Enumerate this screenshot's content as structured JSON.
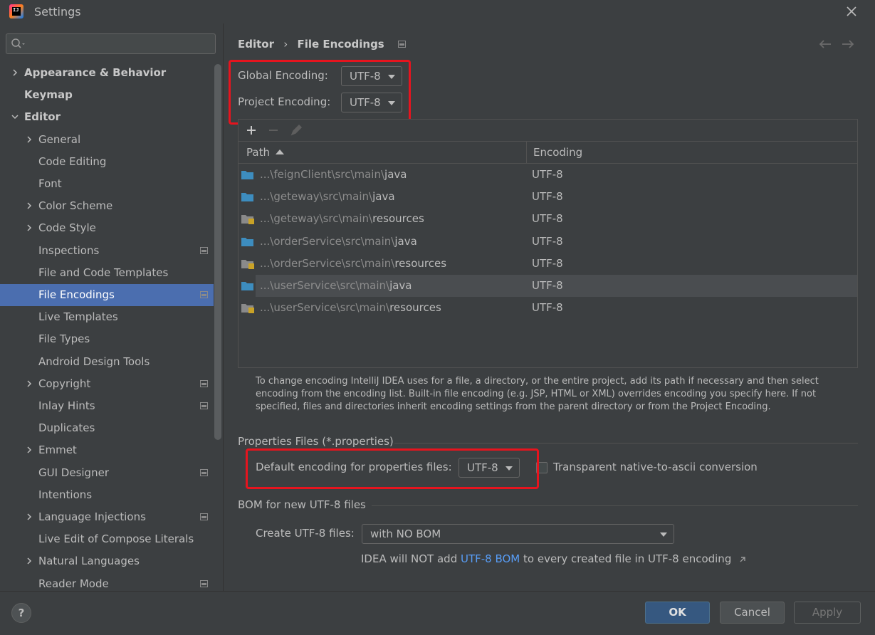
{
  "window": {
    "title": "Settings"
  },
  "search": {
    "placeholder": "",
    "value": ""
  },
  "sidebar": {
    "items": [
      {
        "label": "Appearance & Behavior",
        "chevron": "right",
        "bold": true
      },
      {
        "label": "Keymap",
        "bold": true
      },
      {
        "label": "Editor",
        "chevron": "down",
        "bold": true
      },
      {
        "label": "General",
        "chevron": "right"
      },
      {
        "label": "Code Editing"
      },
      {
        "label": "Font"
      },
      {
        "label": "Color Scheme",
        "chevron": "right"
      },
      {
        "label": "Code Style",
        "chevron": "right"
      },
      {
        "label": "Inspections",
        "project_icon": true
      },
      {
        "label": "File and Code Templates"
      },
      {
        "label": "File Encodings",
        "project_icon": true,
        "selected": true
      },
      {
        "label": "Live Templates"
      },
      {
        "label": "File Types"
      },
      {
        "label": "Android Design Tools"
      },
      {
        "label": "Copyright",
        "chevron": "right",
        "project_icon": true
      },
      {
        "label": "Inlay Hints",
        "project_icon": true
      },
      {
        "label": "Duplicates"
      },
      {
        "label": "Emmet",
        "chevron": "right"
      },
      {
        "label": "GUI Designer",
        "project_icon": true
      },
      {
        "label": "Intentions"
      },
      {
        "label": "Language Injections",
        "chevron": "right",
        "project_icon": true
      },
      {
        "label": "Live Edit of Compose Literals"
      },
      {
        "label": "Natural Languages",
        "chevron": "right"
      },
      {
        "label": "Reader Mode",
        "project_icon": true
      }
    ]
  },
  "breadcrumb": {
    "parent": "Editor",
    "separator": "›",
    "current": "File Encodings"
  },
  "encodings": {
    "global_label": "Global Encoding:",
    "global_value": "UTF-8",
    "project_label": "Project Encoding:",
    "project_value": "UTF-8"
  },
  "table": {
    "toolbar": [
      "add-icon",
      "remove-icon",
      "edit-icon"
    ],
    "columns": {
      "path": "Path",
      "encoding": "Encoding"
    },
    "rows": [
      {
        "prefix": "...\\feignClient\\src\\main\\",
        "leaf": "java",
        "encoding": "UTF-8",
        "icon": "source-folder"
      },
      {
        "prefix": "...\\geteway\\src\\main\\",
        "leaf": "java",
        "encoding": "UTF-8",
        "icon": "source-folder"
      },
      {
        "prefix": "...\\geteway\\src\\main\\",
        "leaf": "resources",
        "encoding": "UTF-8",
        "icon": "resources-folder"
      },
      {
        "prefix": "...\\orderService\\src\\main\\",
        "leaf": "java",
        "encoding": "UTF-8",
        "icon": "source-folder"
      },
      {
        "prefix": "...\\orderService\\src\\main\\",
        "leaf": "resources",
        "encoding": "UTF-8",
        "icon": "resources-folder"
      },
      {
        "prefix": "...\\userService\\src\\main\\",
        "leaf": "java",
        "encoding": "UTF-8",
        "icon": "source-folder",
        "highlighted": true
      },
      {
        "prefix": "...\\userService\\src\\main\\",
        "leaf": "resources",
        "encoding": "UTF-8",
        "icon": "resources-folder"
      }
    ]
  },
  "description": "To change encoding IntelliJ IDEA uses for a file, a directory, or the entire project, add its path if necessary and then select encoding from the encoding list. Built-in file encoding (e.g. JSP, HTML or XML) overrides encoding you specify here. If not specified, files and directories inherit encoding settings from the parent directory or from the Project Encoding.",
  "properties": {
    "section_title": "Properties Files (*.properties)",
    "default_label": "Default encoding for properties files:",
    "default_value": "UTF-8",
    "native_to_ascii_label": "Transparent native-to-ascii conversion",
    "native_to_ascii_checked": false
  },
  "bom": {
    "section_title": "BOM for new UTF-8 files",
    "create_label": "Create UTF-8 files:",
    "create_value": "with NO BOM",
    "hint_prefix": "IDEA will NOT add ",
    "hint_link": "UTF-8 BOM",
    "hint_suffix": " to every created file in UTF-8 encoding"
  },
  "footer": {
    "help": "?",
    "ok": "OK",
    "cancel": "Cancel",
    "apply": "Apply"
  },
  "colors": {
    "accent": "#4b6eaf",
    "ok_button": "#365880",
    "link": "#589df6",
    "highlight_box": "#e6141e"
  }
}
